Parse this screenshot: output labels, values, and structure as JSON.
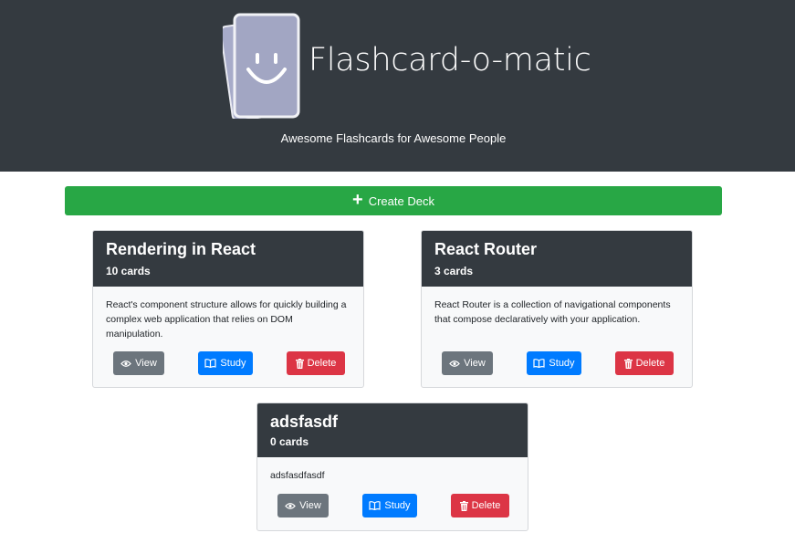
{
  "header": {
    "title": "Flashcard-o-matic",
    "tagline": "Awesome Flashcards for Awesome People",
    "logo_icon": "smiley-flashcards-logo"
  },
  "create_deck": {
    "label": "Create Deck",
    "icon": "plus-icon",
    "color": "#28a745"
  },
  "decks": [
    {
      "name": "Rendering in React",
      "count": "10 cards",
      "description": "React's component structure allows for quickly building a complex web application that relies on DOM manipulation.",
      "view_label": "View",
      "study_label": "Study",
      "delete_label": "Delete"
    },
    {
      "name": "React Router",
      "count": "3 cards",
      "description": "React Router is a collection of navigational components that compose declaratively with your application.",
      "view_label": "View",
      "study_label": "Study",
      "delete_label": "Delete"
    },
    {
      "name": "adsfasdf",
      "count": "0 cards",
      "description": "adsfasdfasdf",
      "view_label": "View",
      "study_label": "Study",
      "delete_label": "Delete"
    }
  ],
  "colors": {
    "header_bg": "#343a40",
    "view": "#6c757d",
    "study": "#007bff",
    "delete": "#dc3545"
  }
}
